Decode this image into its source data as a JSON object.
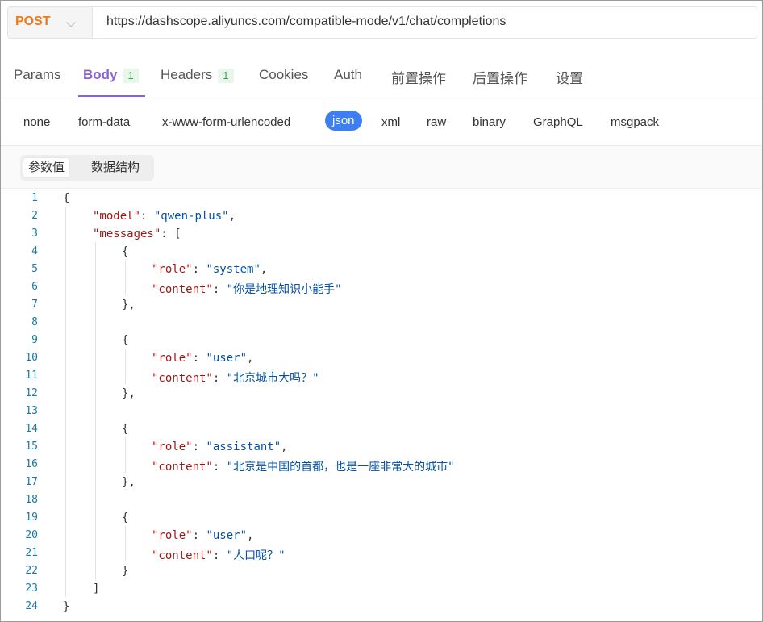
{
  "request": {
    "method": "POST",
    "url": "https://dashscope.aliyuncs.com/compatible-mode/v1/chat/completions"
  },
  "tabs": [
    {
      "label": "Params"
    },
    {
      "label": "Body",
      "badge": "1"
    },
    {
      "label": "Headers",
      "badge": "1"
    },
    {
      "label": "Cookies"
    },
    {
      "label": "Auth"
    },
    {
      "label": "前置操作"
    },
    {
      "label": "后置操作"
    },
    {
      "label": "设置"
    }
  ],
  "active_tab": "Body",
  "body_types": [
    "none",
    "form-data",
    "x-www-form-urlencoded",
    "json",
    "xml",
    "raw",
    "binary",
    "GraphQL",
    "msgpack"
  ],
  "active_body_type": "json",
  "param_tabs": [
    "参数值",
    "数据结构"
  ],
  "active_param_tab": "参数值",
  "colors": {
    "method": "#ef7a1a",
    "tab_active": "#8a63d2",
    "badge_text": "#31a354",
    "json_pill": "#3d7ff0",
    "json_key": "#a31515",
    "json_string": "#0451a5",
    "line_number": "#1a7aa8"
  },
  "code": {
    "line_numbers": [
      "1",
      "2",
      "3",
      "4",
      "5",
      "6",
      "7",
      "8",
      "9",
      "10",
      "11",
      "12",
      "13",
      "14",
      "15",
      "16",
      "17",
      "18",
      "19",
      "20",
      "21",
      "22",
      "23",
      "24"
    ],
    "tokens": {
      "brace_open": "{",
      "brace_close": "}",
      "brace_close_comma": "},",
      "bracket_open": "[",
      "bracket_close": "]",
      "colon": ": ",
      "comma": ",",
      "key_model": "\"model\"",
      "val_model": "\"qwen-plus\"",
      "key_messages": "\"messages\"",
      "key_role": "\"role\"",
      "key_content": "\"content\"",
      "role_system": "\"system\"",
      "role_user": "\"user\"",
      "role_assistant": "\"assistant\"",
      "content_1": "\"你是地理知识小能手\"",
      "content_2": "\"北京城市大吗？\"",
      "content_3": "\"北京是中国的首都，也是一座非常大的城市\"",
      "content_4": "\"人口呢？\""
    }
  }
}
